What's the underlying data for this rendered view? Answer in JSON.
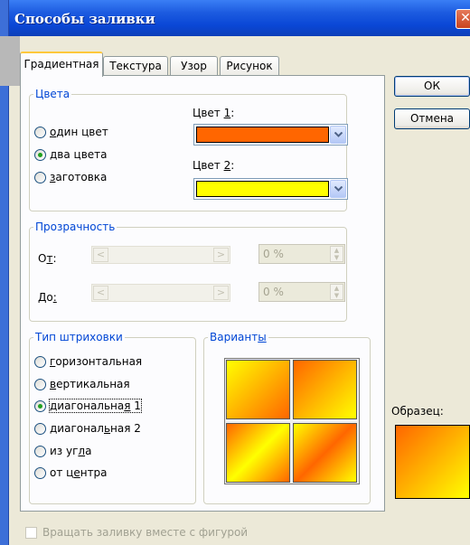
{
  "window": {
    "title": "Способы заливки",
    "close_glyph": "✕"
  },
  "tabs": [
    {
      "label": "Градиентная",
      "active": true
    },
    {
      "label": "Текстура",
      "active": false
    },
    {
      "label": "Узор",
      "active": false
    },
    {
      "label": "Рисунок",
      "active": false
    }
  ],
  "colors_group": {
    "legend": "Цвета",
    "options": [
      {
        "pre": "",
        "key": "о",
        "post": "дин цвет",
        "checked": false
      },
      {
        "pre": "",
        "key": "д",
        "post": "ва цвета",
        "checked": true
      },
      {
        "pre": "",
        "key": "з",
        "post": "аготовка",
        "checked": false
      }
    ],
    "color1": {
      "pre": "Цвет ",
      "key": "1",
      "post": ":",
      "value": "#ff6600"
    },
    "color2": {
      "pre": "Цвет ",
      "key": "2",
      "post": ":",
      "value": "#ffff00"
    }
  },
  "transparency_group": {
    "legend": "Прозрачность",
    "from": {
      "pre": "О",
      "key": "т",
      "post": ":",
      "value": "0 %"
    },
    "to": {
      "pre": "До",
      "key": ":",
      "post": "",
      "value": "0 %"
    }
  },
  "hatch_group": {
    "legend": "Тип штриховки",
    "options": [
      {
        "pre": "",
        "key": "г",
        "post": "оризонтальная",
        "checked": false
      },
      {
        "pre": "",
        "key": "в",
        "post": "ертикальная",
        "checked": false
      },
      {
        "pre": "диагональна",
        "key": "я",
        "post": " 1",
        "checked": true
      },
      {
        "pre": "диагонал",
        "key": "ь",
        "post": "ная 2",
        "checked": false
      },
      {
        "pre": "из уг",
        "key": "л",
        "post": "а",
        "checked": false
      },
      {
        "pre": "от ц",
        "key": "е",
        "post": "нтра",
        "checked": false
      }
    ]
  },
  "variants_group": {
    "pre": "Вариант",
    "key": "ы",
    "post": ""
  },
  "buttons": {
    "ok": "ОК",
    "cancel": "Отмена"
  },
  "sample": {
    "label": "Образец:"
  },
  "rotate_checkbox": {
    "label": "Вращать заливку вместе с фигурой",
    "checked": false,
    "enabled": false
  }
}
